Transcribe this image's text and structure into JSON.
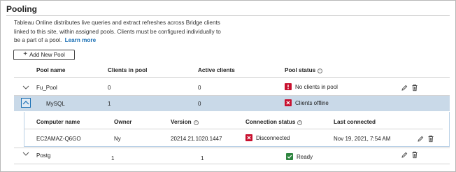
{
  "section": {
    "title": "Pooling",
    "description": "Tableau Online distributes live queries and extract refreshes across Bridge clients linked to this site, within assigned pools. Clients must be configured individually to be a part of a pool.",
    "learn_more": "Learn more"
  },
  "toolbar": {
    "add_button_label": "Add New Pool",
    "add_button_glyph": "+"
  },
  "pools_table": {
    "columns": {
      "name": "Pool name",
      "clients": "Clients in pool",
      "active": "Active clients",
      "status": "Pool status"
    },
    "rows": [
      {
        "name": "Fu_Pool",
        "clients": "0",
        "active": "0",
        "status": "No clients in pool",
        "status_kind": "error",
        "expanded": false
      },
      {
        "name": "MySQL",
        "clients": "1",
        "active": "0",
        "status": "Clients offline",
        "status_kind": "offline",
        "expanded": true
      },
      {
        "name": "Postg",
        "clients": "1",
        "active": "1",
        "status": "Ready",
        "status_kind": "ready",
        "expanded": false
      }
    ]
  },
  "clients_table": {
    "columns": {
      "computer": "Computer name",
      "owner": "Owner",
      "version": "Version",
      "connection": "Connection status",
      "last": "Last connected"
    },
    "rows": [
      {
        "computer": "EC2AMAZ-Q6GO",
        "owner": "Ny",
        "version": "20214.21.1020.1447",
        "connection": "Disconnected",
        "last": "Nov 19, 2021, 7:54 AM"
      }
    ]
  },
  "colors": {
    "error": "#c8102e",
    "ready": "#2e8540",
    "link": "#1a6fb4",
    "selected_row": "#c9d9e8"
  },
  "icons": {
    "info": "info-icon",
    "edit": "pencil-icon",
    "delete": "trash-icon",
    "expand": "chevron-down-icon",
    "collapse": "chevron-up-icon"
  }
}
